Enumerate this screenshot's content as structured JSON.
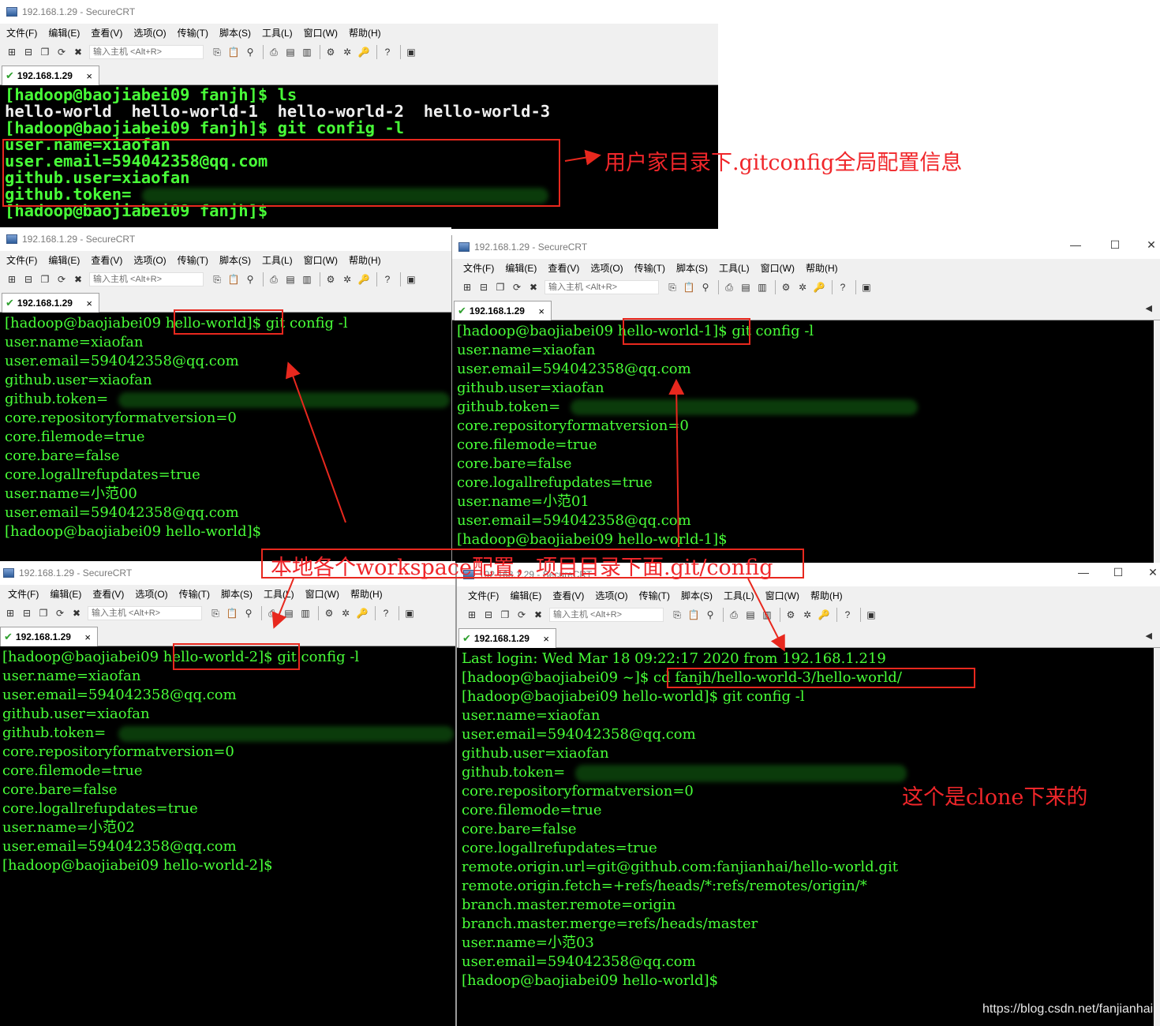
{
  "app": {
    "window_title": "192.168.1.29 - SecureCRT",
    "menu": [
      "文件(F)",
      "编辑(E)",
      "查看(V)",
      "选项(O)",
      "传输(T)",
      "脚本(S)",
      "工具(L)",
      "窗口(W)",
      "帮助(H)"
    ],
    "host_placeholder": "输入主机 <Alt+R>",
    "tab_label": "192.168.1.29",
    "tab_close": "×",
    "minimize": "—",
    "maximize": "☐",
    "close": "✕"
  },
  "windows": {
    "top": {
      "lines": [
        "[hadoop@baojiabei09 fanjh]$ ls",
        "hello-world  hello-world-1  hello-world-2  hello-world-3",
        "[hadoop@baojiabei09 fanjh]$ git config -l",
        "user.name=xiaofan",
        "user.email=594042358@qq.com",
        "github.user=xiaofan",
        "github.token=",
        "[hadoop@baojiabei09 fanjh]$"
      ]
    },
    "w1": {
      "lines": [
        "[hadoop@baojiabei09 hello-world]$ git config -l",
        "user.name=xiaofan",
        "user.email=594042358@qq.com",
        "github.user=xiaofan",
        "github.token=",
        "core.repositoryformatversion=0",
        "core.filemode=true",
        "core.bare=false",
        "core.logallrefupdates=true",
        "user.name=小范00",
        "user.email=594042358@qq.com",
        "[hadoop@baojiabei09 hello-world]$"
      ]
    },
    "w2": {
      "lines": [
        "[hadoop@baojiabei09 hello-world-1]$ git config -l",
        "user.name=xiaofan",
        "user.email=594042358@qq.com",
        "github.user=xiaofan",
        "github.token=",
        "core.repositoryformatversion=0",
        "core.filemode=true",
        "core.bare=false",
        "core.logallrefupdates=true",
        "user.name=小范01",
        "user.email=594042358@qq.com",
        "[hadoop@baojiabei09 hello-world-1]$"
      ]
    },
    "w3": {
      "lines": [
        "[hadoop@baojiabei09 hello-world-2]$ git config -l",
        "user.name=xiaofan",
        "user.email=594042358@qq.com",
        "github.user=xiaofan",
        "github.token=",
        "core.repositoryformatversion=0",
        "core.filemode=true",
        "core.bare=false",
        "core.logallrefupdates=true",
        "user.name=小范02",
        "user.email=594042358@qq.com",
        "[hadoop@baojiabei09 hello-world-2]$"
      ]
    },
    "w4": {
      "lines": [
        "Last login: Wed Mar 18 09:22:17 2020 from 192.168.1.219",
        "[hadoop@baojiabei09 ~]$ cd fanjh/hello-world-3/hello-world/",
        "[hadoop@baojiabei09 hello-world]$ git config -l",
        "user.name=xiaofan",
        "user.email=594042358@qq.com",
        "github.user=xiaofan",
        "github.token=",
        "core.repositoryformatversion=0",
        "core.filemode=true",
        "core.bare=false",
        "core.logallrefupdates=true",
        "remote.origin.url=git@github.com:fanjianhai/hello-world.git",
        "remote.origin.fetch=+refs/heads/*:refs/remotes/origin/*",
        "branch.master.remote=origin",
        "branch.master.merge=refs/heads/master",
        "user.name=小范03",
        "user.email=594042358@qq.com",
        "[hadoop@baojiabei09 hello-world]$"
      ]
    }
  },
  "annotations": {
    "global": "用户家目录下.gitconfig全局配置信息",
    "local": "本地各个workspace配置，项目目录下面.git/config",
    "clone": "这个是clone下来的"
  },
  "watermark": "https://blog.csdn.net/fanjianhai",
  "colors": {
    "terminal_bg": "#000000",
    "terminal_fg": "#48ff38",
    "annotation_red": "#e8281e"
  }
}
